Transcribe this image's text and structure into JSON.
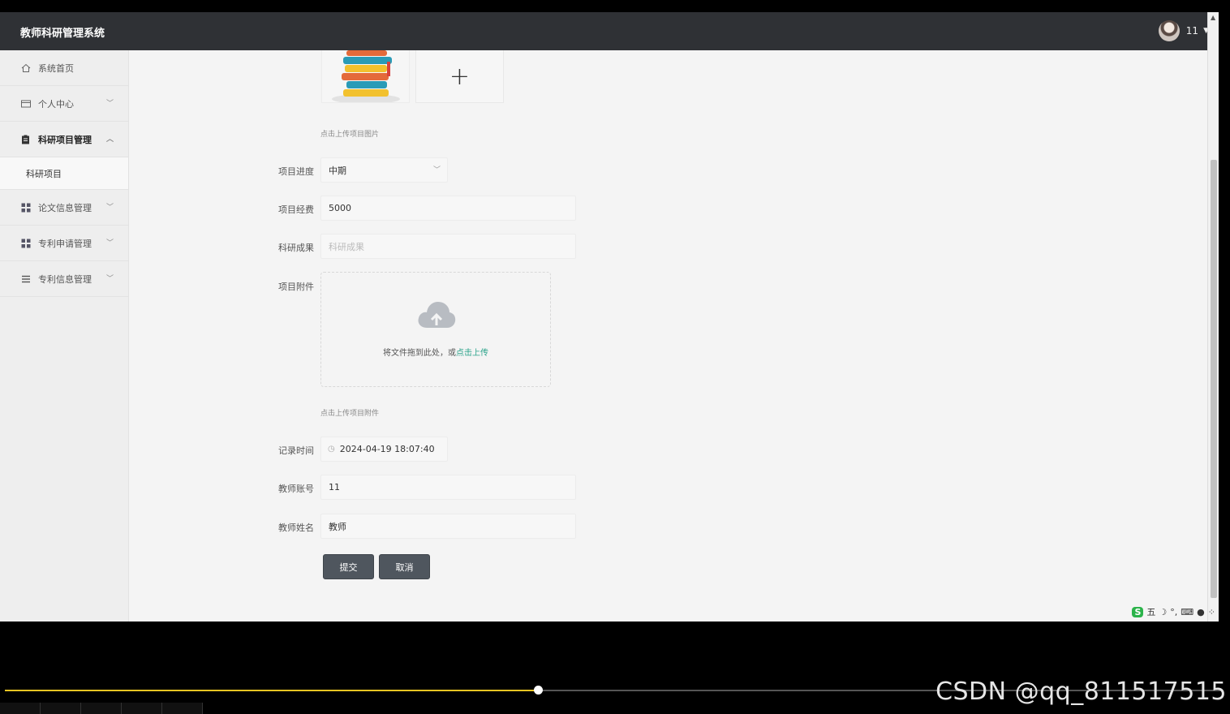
{
  "app": {
    "title": "教师科研管理系统",
    "user_name": "11",
    "user_caret": "▼"
  },
  "sidebar": {
    "items": [
      {
        "label": "系统首页",
        "icon": "home-icon",
        "caret": ""
      },
      {
        "label": "个人中心",
        "icon": "id-card-icon",
        "caret": "﹀"
      },
      {
        "label": "科研项目管理",
        "icon": "clipboard-icon",
        "caret": "︿"
      },
      {
        "label": "论文信息管理",
        "icon": "grid-icon",
        "caret": "﹀"
      },
      {
        "label": "专利申请管理",
        "icon": "grid-icon",
        "caret": "﹀"
      },
      {
        "label": "专利信息管理",
        "icon": "list-icon",
        "caret": "﹀"
      }
    ],
    "submenu": {
      "label": "科研项目"
    }
  },
  "form": {
    "image_add": "+",
    "image_tip": "点击上传项目图片",
    "progress": {
      "label": "项目进度",
      "value": "中期"
    },
    "funding": {
      "label": "项目经费",
      "value": "5000"
    },
    "achievement": {
      "label": "科研成果",
      "placeholder": "科研成果"
    },
    "attachment": {
      "label": "项目附件",
      "drop_text": "将文件拖到此处，或",
      "link_text": "点击上传",
      "tip": "点击上传项目附件"
    },
    "record_time": {
      "label": "记录时间",
      "value": "2024-04-19 18:07:40"
    },
    "teacher_account": {
      "label": "教师账号",
      "value": "11"
    },
    "teacher_name": {
      "label": "教师姓名",
      "value": "教师"
    },
    "submit_label": "提交",
    "cancel_label": "取消"
  },
  "ime": {
    "logo": "S",
    "mode": "五",
    "icons": [
      "moon-icon",
      "punctuation-icon",
      "keyboard-icon",
      "user-icon",
      "apps-icon"
    ]
  },
  "video": {
    "progress": 0.438
  },
  "watermark": "CSDN @qq_811517515",
  "colors": {
    "header_bg": "#2f3135",
    "accent_link": "#2aa38a",
    "button_bg": "#4f565e",
    "progress": "#e8c422"
  }
}
